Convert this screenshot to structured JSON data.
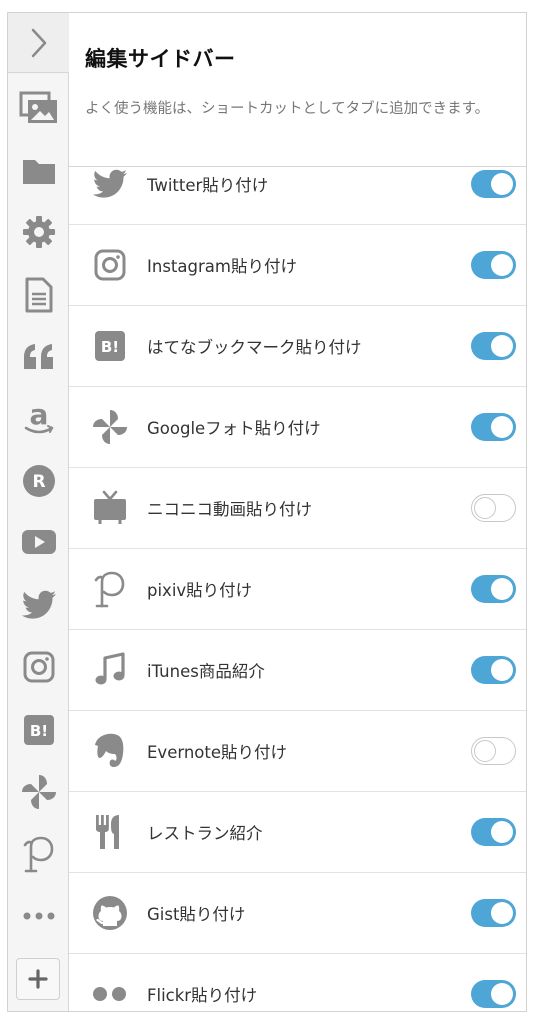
{
  "panel": {
    "title": "編集サイドバー",
    "description": "よく使う機能は、ショートカットとしてタブに追加できます。"
  },
  "rail": {
    "collapse_icon": "chevron-right-icon",
    "add_icon": "plus-icon",
    "items": [
      {
        "icon": "image-icon"
      },
      {
        "icon": "folder-icon"
      },
      {
        "icon": "gear-icon"
      },
      {
        "icon": "document-icon"
      },
      {
        "icon": "quote-icon"
      },
      {
        "icon": "amazon-icon"
      },
      {
        "icon": "rakuten-icon"
      },
      {
        "icon": "youtube-icon"
      },
      {
        "icon": "twitter-icon"
      },
      {
        "icon": "instagram-icon"
      },
      {
        "icon": "hatena-bookmark-icon"
      },
      {
        "icon": "google-photos-icon"
      },
      {
        "icon": "pixiv-icon"
      },
      {
        "icon": "more-icon"
      }
    ]
  },
  "items": [
    {
      "icon": "twitter-icon",
      "label": "Twitter貼り付け",
      "enabled": true
    },
    {
      "icon": "instagram-icon",
      "label": "Instagram貼り付け",
      "enabled": true
    },
    {
      "icon": "hatena-bookmark-icon",
      "label": "はてなブックマーク貼り付け",
      "enabled": true
    },
    {
      "icon": "google-photos-icon",
      "label": "Googleフォト貼り付け",
      "enabled": true
    },
    {
      "icon": "niconico-icon",
      "label": "ニコニコ動画貼り付け",
      "enabled": false
    },
    {
      "icon": "pixiv-icon",
      "label": "pixiv貼り付け",
      "enabled": true
    },
    {
      "icon": "music-note-icon",
      "label": "iTunes商品紹介",
      "enabled": true
    },
    {
      "icon": "evernote-icon",
      "label": "Evernote貼り付け",
      "enabled": false
    },
    {
      "icon": "restaurant-icon",
      "label": "レストラン紹介",
      "enabled": true
    },
    {
      "icon": "github-icon",
      "label": "Gist貼り付け",
      "enabled": true
    },
    {
      "icon": "flickr-icon",
      "label": "Flickr貼り付け",
      "enabled": true
    }
  ],
  "colors": {
    "toggle_on": "#4da6d6",
    "toggle_off_border": "#c8c8c8",
    "icon_gray": "#8a8a8a",
    "rail_background": "#f5f5f5"
  }
}
